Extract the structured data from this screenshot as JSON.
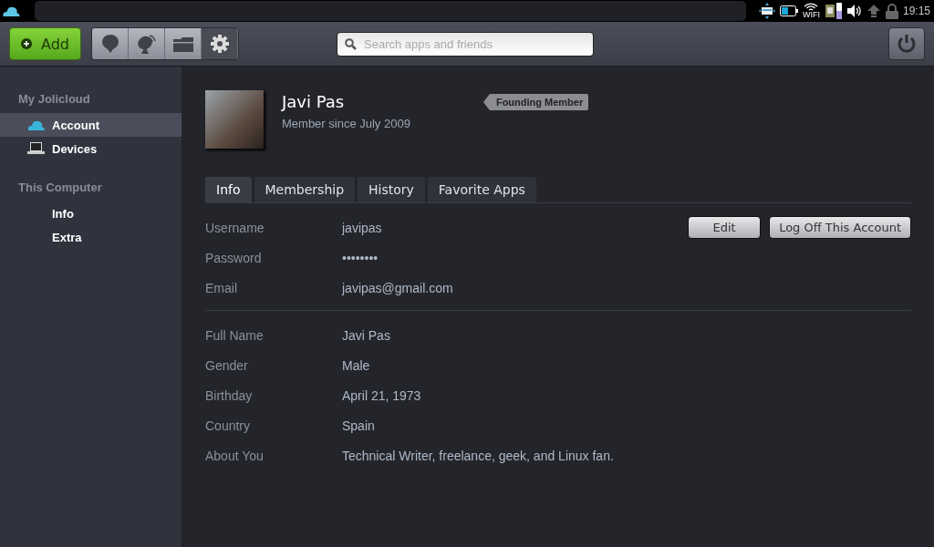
{
  "top_panel": {
    "wifi_label": "WIFI",
    "clock": "19:15"
  },
  "toolbar": {
    "add_button": "Add",
    "nav": [
      {
        "kind": "apps",
        "selected": false
      },
      {
        "kind": "dish",
        "selected": false
      },
      {
        "kind": "folder",
        "selected": false
      },
      {
        "kind": "settings",
        "selected": true
      }
    ],
    "search": {
      "placeholder": "Search apps and friends"
    }
  },
  "sidebar": {
    "sections": [
      {
        "title": "My Jolicloud",
        "items": [
          {
            "label": "Account",
            "kind": "cloud",
            "selected": true
          },
          {
            "label": "Devices",
            "kind": "laptop",
            "selected": false
          }
        ]
      },
      {
        "title": "This Computer",
        "items": [
          {
            "label": "Info",
            "kind": "plain",
            "selected": false
          },
          {
            "label": "Extra",
            "kind": "plain",
            "selected": false
          }
        ]
      }
    ]
  },
  "profile": {
    "name": "Javi Pas",
    "member_since": "Member since July 2009",
    "badge": "Founding Member"
  },
  "tabs": [
    {
      "label": "Info",
      "selected": true
    },
    {
      "label": "Membership",
      "selected": false
    },
    {
      "label": "History",
      "selected": false
    },
    {
      "label": "Favorite Apps",
      "selected": false
    }
  ],
  "account": {
    "fields": [
      {
        "label": "Username",
        "value": "javipas"
      },
      {
        "label": "Password",
        "value": "••••••••"
      },
      {
        "label": "Email",
        "value": "javipas@gmail.com"
      }
    ],
    "buttons": [
      "Edit",
      "Log Off This Account"
    ]
  },
  "personal": {
    "fields": [
      {
        "label": "Full Name",
        "value": "Javi Pas"
      },
      {
        "label": "Gender",
        "value": "Male"
      },
      {
        "label": "Birthday",
        "value": "April 21, 1973"
      },
      {
        "label": "Country",
        "value": "Spain"
      },
      {
        "label": "About You",
        "value": "Technical Writer, freelance, geek, and Linux fan."
      }
    ]
  }
}
